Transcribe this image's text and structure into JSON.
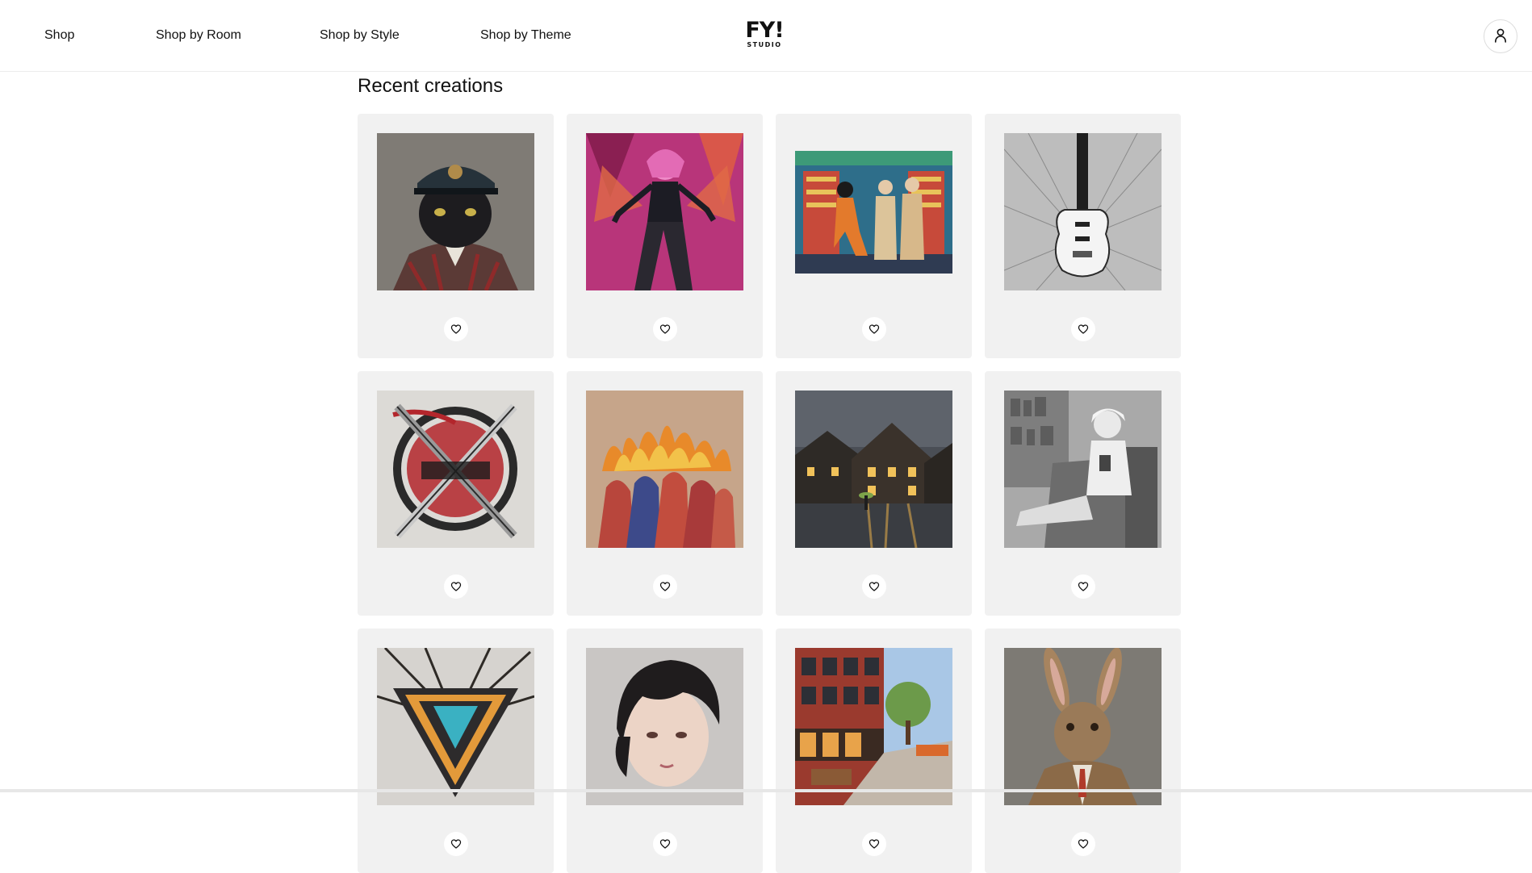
{
  "header": {
    "nav": [
      "Shop",
      "Shop by Room",
      "Shop by Style",
      "Shop by Theme"
    ],
    "logo": {
      "main": "FY!",
      "sub": "STUDIO"
    },
    "account_icon": "user-icon"
  },
  "section": {
    "title": "Recent creations"
  },
  "cards": [
    {
      "image": "cat-in-military-cap-artwork",
      "fav_icon": "heart-icon"
    },
    {
      "image": "pink-haired-demon-girl-artwork",
      "fav_icon": "heart-icon"
    },
    {
      "image": "retro-shop-couple-comic-artwork",
      "fav_icon": "heart-icon"
    },
    {
      "image": "sketched-electric-guitar-artwork",
      "fav_icon": "heart-icon"
    },
    {
      "image": "crossed-swords-emblem-artwork",
      "fav_icon": "heart-icon"
    },
    {
      "image": "figures-in-flames-painting",
      "fav_icon": "heart-icon"
    },
    {
      "image": "rainy-town-street-night-artwork",
      "fav_icon": "heart-icon"
    },
    {
      "image": "woman-reading-armchair-sketch",
      "fav_icon": "heart-icon"
    },
    {
      "image": "triangle-v-emblem-artwork",
      "fav_icon": "heart-icon"
    },
    {
      "image": "short-haired-girl-portrait",
      "fav_icon": "heart-icon"
    },
    {
      "image": "shopping-street-plaza-render",
      "fav_icon": "heart-icon"
    },
    {
      "image": "hare-in-tweed-suit-painting",
      "fav_icon": "heart-icon"
    }
  ],
  "colors": {
    "card_bg": "#f1f1f1",
    "text": "#111111",
    "divider": "#ececec"
  }
}
